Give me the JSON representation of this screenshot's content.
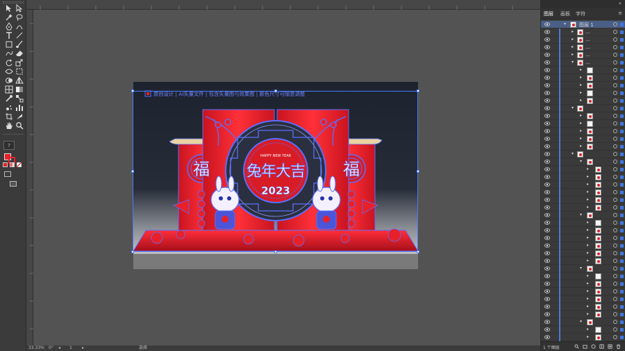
{
  "toolbar": {
    "tools": [
      "selection-tool",
      "direct-selection-tool",
      "magic-wand-tool",
      "lasso-tool",
      "pen-tool",
      "curvature-tool",
      "type-tool",
      "line-tool",
      "rectangle-tool",
      "paintbrush-tool",
      "shaper-tool",
      "eraser-tool",
      "rotate-tool",
      "scale-tool",
      "width-tool",
      "free-transform-tool",
      "shape-builder-tool",
      "perspective-tool",
      "mesh-tool",
      "gradient-tool",
      "eyedropper-tool",
      "blend-tool",
      "symbol-sprayer-tool",
      "column-graph-tool",
      "artboard-tool",
      "slice-tool",
      "hand-tool",
      "zoom-tool"
    ],
    "help_label": "?"
  },
  "artwork": {
    "header_text": "原创设计 | AI矢量文件 | 包含矢量图与效果图 | 颜色尺寸可随意调整",
    "left_panel_char": "福",
    "right_panel_char": "福",
    "title_char_1": "兔",
    "title_char_2": "年",
    "title_char_3": "大",
    "title_char_4": "吉",
    "year_text": "2023",
    "subtitle_text": "HAPPY NEW YEAR",
    "colors": {
      "red": "#e8202a",
      "outline": "#5a6fff",
      "bg_dark": "#1f2530",
      "gold": "#e9d3a0"
    }
  },
  "statusbar": {
    "zoom": "33.33%",
    "rotation": "0°",
    "artboard_num": "1",
    "mode": "选择"
  },
  "panel": {
    "tabs": [
      "图层",
      "画板",
      "字符"
    ],
    "top_layer_name": "图层 1",
    "sublayer_name": "...",
    "footer_text": "1 个图层"
  }
}
